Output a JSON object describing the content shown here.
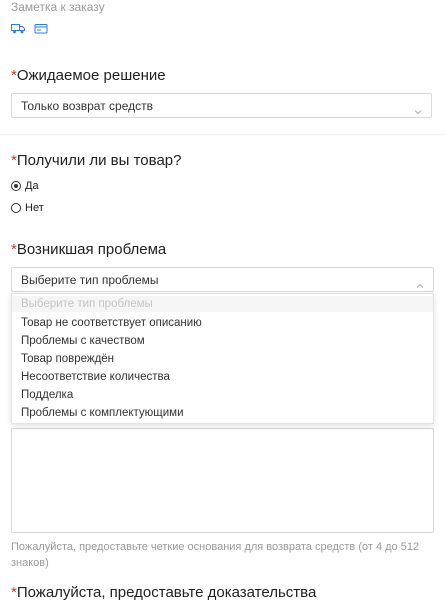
{
  "note": {
    "label": "Заметка к заказу"
  },
  "expected_solution": {
    "required_mark": "*",
    "title": "Ожидаемое решение",
    "value": "Только возврат средств"
  },
  "received_item": {
    "required_mark": "*",
    "title": "Получили ли вы товар?",
    "options": [
      {
        "label": "Да",
        "checked": true
      },
      {
        "label": "Нет",
        "checked": false
      }
    ]
  },
  "problem": {
    "required_mark": "*",
    "title": "Возникшая проблема",
    "placeholder": "Выберите тип проблемы",
    "options": [
      "Выберите тип проблемы",
      "Товар не соответствует описанию",
      "Проблемы с качеством",
      "Товар повреждён",
      "Несоответствие количества",
      "Подделка",
      "Проблемы с комплектующими"
    ]
  },
  "reason": {
    "hint": "Пожалуйста, предоставьте четкие основания для возврата средств (от 4 до 512 знаков)"
  },
  "evidence": {
    "required_mark": "*",
    "title": "Пожалуйста, предоставьте доказательства"
  },
  "icons": {
    "truck": "truck-icon",
    "card": "card-icon"
  },
  "colors": {
    "required": "#d0342c",
    "icon_blue": "#2f7fd6"
  }
}
